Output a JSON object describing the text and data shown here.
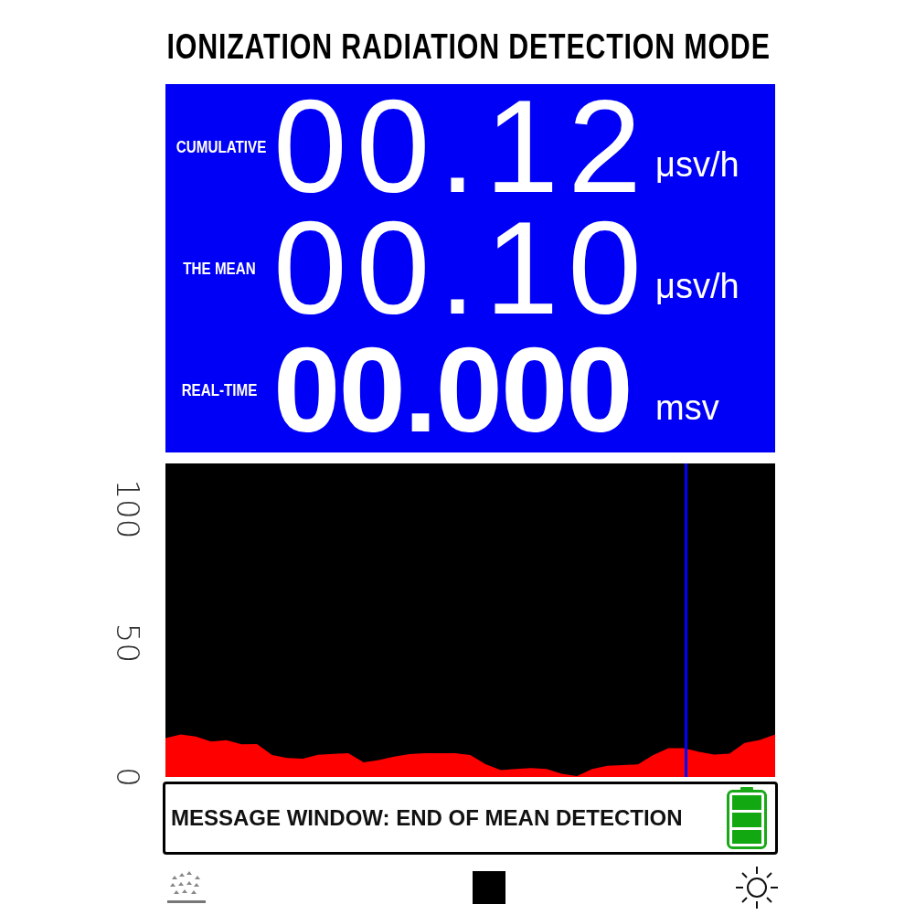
{
  "title": "IONIZATION RADIATION DETECTION MODE",
  "readings": [
    {
      "label": "CUMULATIVE",
      "value": "00.12",
      "unit": "μsv/h",
      "bold": false
    },
    {
      "label": "THE MEAN",
      "value": "00.10",
      "unit": "μsv/h",
      "bold": false
    },
    {
      "label": "REAL-TIME",
      "value": "00.000",
      "unit": "msv",
      "bold": true
    }
  ],
  "chart_data": {
    "type": "area",
    "ylim": [
      0,
      117
    ],
    "yticks": [
      {
        "value": 0,
        "label": "0"
      },
      {
        "value": 50,
        "label": "50"
      },
      {
        "value": 100,
        "label": "100"
      }
    ],
    "categories": [
      null,
      null,
      null,
      null,
      null,
      null,
      null,
      null,
      null,
      null,
      null,
      null,
      null,
      null,
      null,
      null,
      null,
      null,
      null,
      null,
      null,
      null,
      null,
      null,
      null,
      null,
      null,
      null,
      null,
      null,
      null,
      null,
      null,
      null,
      null,
      null,
      null,
      null,
      null,
      null,
      null
    ],
    "series": [
      {
        "color": "#ff0000",
        "values": [
          14.5,
          15.9,
          15.1,
          13.2,
          13.7,
          12.2,
          12.3,
          8.2,
          7.1,
          6.8,
          8.3,
          8.6,
          8.9,
          5.5,
          6.3,
          7.6,
          8.5,
          8.9,
          8.9,
          8.9,
          8.2,
          4.8,
          2.6,
          3.0,
          3.3,
          3.0,
          1.2,
          0.3,
          3.0,
          4.2,
          4.4,
          4.7,
          8.2,
          10.7,
          10.7,
          9.4,
          8.4,
          8.7,
          12.7,
          13.8,
          15.9
        ]
      }
    ]
  },
  "message": "MESSAGE WINDOW: END OF MEAN DETECTION"
}
